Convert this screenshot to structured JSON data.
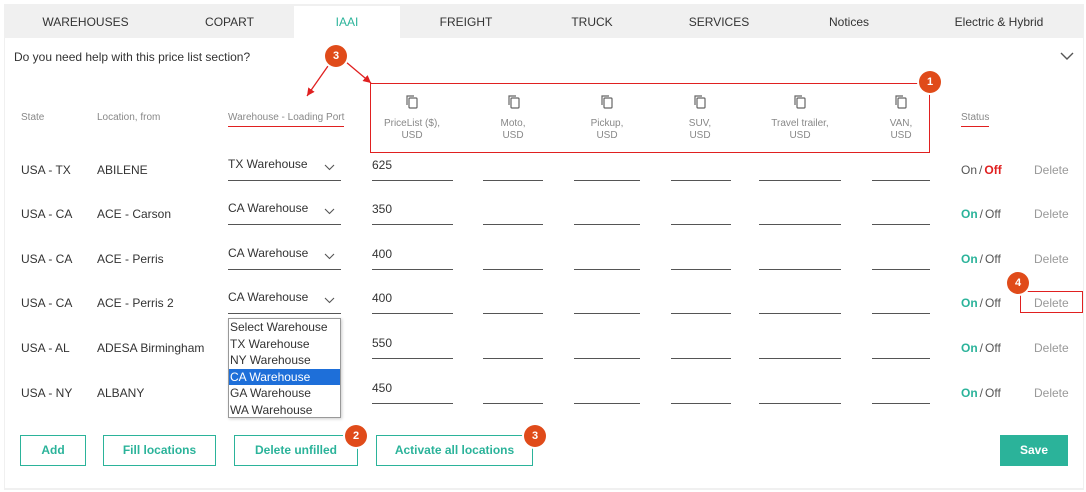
{
  "tabs": [
    {
      "label": "WAREHOUSES"
    },
    {
      "label": "COPART"
    },
    {
      "label": "IAAI"
    },
    {
      "label": "FREIGHT"
    },
    {
      "label": "TRUCK"
    },
    {
      "label": "SERVICES"
    },
    {
      "label": "Notices"
    },
    {
      "label": "Electric & Hybrid"
    }
  ],
  "active_tab": "IAAI",
  "help": {
    "text": "Do you need help with this price list section?"
  },
  "columns": {
    "state": "State",
    "location": "Location, from",
    "warehouse": "Warehouse - Loading Port",
    "pricelist": [
      "PriceList ($),",
      "USD"
    ],
    "moto": [
      "Moto,",
      "USD"
    ],
    "pickup": [
      "Pickup,",
      "USD"
    ],
    "suv": [
      "SUV,",
      "USD"
    ],
    "travel": [
      "Travel trailer,",
      "USD"
    ],
    "van": [
      "VAN,",
      "USD"
    ],
    "status": "Status"
  },
  "on_label": "On",
  "off_label": "Off",
  "slash": "/",
  "delete_label": "Delete",
  "rows": [
    {
      "state": "USA - TX",
      "location": "ABILENE",
      "warehouse": "TX Warehouse",
      "price": "625",
      "status": "off"
    },
    {
      "state": "USA - CA",
      "location": "ACE - Carson",
      "warehouse": "CA Warehouse",
      "price": "350",
      "status": "on"
    },
    {
      "state": "USA - CA",
      "location": "ACE - Perris",
      "warehouse": "CA Warehouse",
      "price": "400",
      "status": "on"
    },
    {
      "state": "USA - CA",
      "location": "ACE - Perris 2",
      "warehouse": "CA Warehouse",
      "price": "400",
      "status": "on"
    },
    {
      "state": "USA - AL",
      "location": "ADESA Birmingham",
      "warehouse": "",
      "price": "550",
      "status": "on"
    },
    {
      "state": "USA - NY",
      "location": "ALBANY",
      "warehouse": "",
      "price": "450",
      "status": "on"
    }
  ],
  "dropdown": {
    "options": [
      "Select Warehouse",
      "TX Warehouse",
      "NY Warehouse",
      "CA Warehouse",
      "GA Warehouse",
      "WA Warehouse"
    ],
    "selected": "CA Warehouse"
  },
  "buttons": {
    "add": "Add",
    "fill": "Fill locations",
    "delete_unfilled": "Delete unfilled",
    "activate": "Activate all locations",
    "save": "Save"
  },
  "badges": {
    "b1": "1",
    "b2": "2",
    "b3a": "3",
    "b3b": "3",
    "b4": "4"
  },
  "colors": {
    "accent": "#2bb39a",
    "red": "#e02020",
    "badge": "#e04b1a",
    "selected": "#1e6fd9"
  }
}
